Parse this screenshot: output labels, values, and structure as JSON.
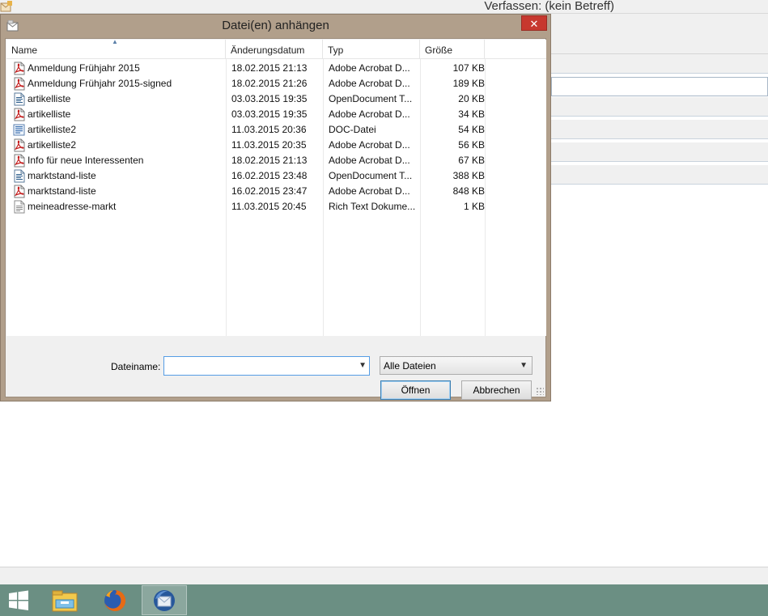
{
  "background_window": {
    "title": "Verfassen: (kein Betreff)"
  },
  "dialog": {
    "title": "Datei(en) anhängen",
    "close_label": "✕",
    "columns": {
      "name": "Name",
      "date": "Änderungsdatum",
      "type": "Typ",
      "size": "Größe"
    },
    "files": [
      {
        "icon": "pdf-file-icon",
        "name": "Anmeldung Frühjahr 2015",
        "date": "18.02.2015 21:13",
        "type": "Adobe Acrobat D...",
        "size": "107 KB"
      },
      {
        "icon": "pdf-file-icon",
        "name": "Anmeldung Frühjahr 2015-signed",
        "date": "18.02.2015 21:26",
        "type": "Adobe Acrobat D...",
        "size": "189 KB"
      },
      {
        "icon": "odt-file-icon",
        "name": "artikelliste",
        "date": "03.03.2015 19:35",
        "type": "OpenDocument T...",
        "size": "20 KB"
      },
      {
        "icon": "pdf-file-icon",
        "name": "artikelliste",
        "date": "03.03.2015 19:35",
        "type": "Adobe Acrobat D...",
        "size": "34 KB"
      },
      {
        "icon": "doc-file-icon",
        "name": "artikelliste2",
        "date": "11.03.2015 20:36",
        "type": "DOC-Datei",
        "size": "54 KB"
      },
      {
        "icon": "pdf-file-icon",
        "name": "artikelliste2",
        "date": "11.03.2015 20:35",
        "type": "Adobe Acrobat D...",
        "size": "56 KB"
      },
      {
        "icon": "pdf-file-icon",
        "name": "Info für neue Interessenten",
        "date": "18.02.2015 21:13",
        "type": "Adobe Acrobat D...",
        "size": "67 KB"
      },
      {
        "icon": "odt-file-icon",
        "name": "marktstand-liste",
        "date": "16.02.2015 23:48",
        "type": "OpenDocument T...",
        "size": "388 KB"
      },
      {
        "icon": "pdf-file-icon",
        "name": "marktstand-liste",
        "date": "16.02.2015 23:47",
        "type": "Adobe Acrobat D...",
        "size": "848 KB"
      },
      {
        "icon": "rtf-file-icon",
        "name": "meineadresse-markt",
        "date": "11.03.2015 20:45",
        "type": "Rich Text Dokume...",
        "size": "1 KB"
      }
    ],
    "filename_label": "Dateiname:",
    "filename_value": "",
    "filter_value": "Alle Dateien",
    "open_button": "Öffnen",
    "cancel_button": "Abbrechen"
  },
  "taskbar": {
    "items": [
      "windows-start-icon",
      "file-explorer-icon",
      "firefox-icon",
      "thunderbird-icon"
    ]
  },
  "colors": {
    "dialog_frame": "#b19f8b",
    "close_button": "#c7382e",
    "taskbar": "#6b8f83",
    "focus_border": "#569de5"
  }
}
